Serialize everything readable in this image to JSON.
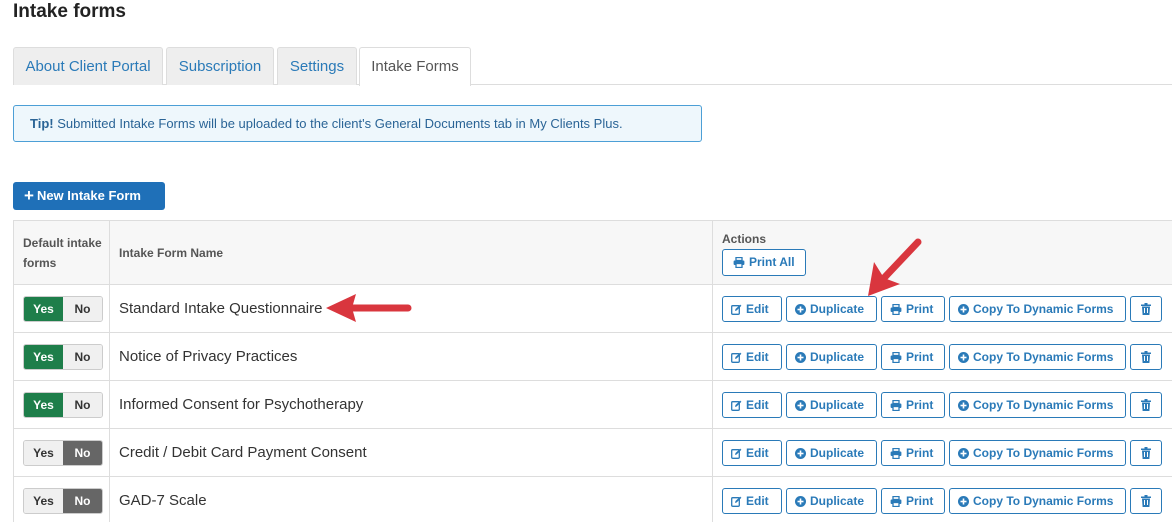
{
  "page": {
    "title": "Intake forms"
  },
  "tabs": [
    {
      "label": "About Client Portal",
      "active": false
    },
    {
      "label": "Subscription",
      "active": false
    },
    {
      "label": "Settings",
      "active": false
    },
    {
      "label": "Intake Forms",
      "active": true
    }
  ],
  "tip": {
    "strong": "Tip!",
    "text": " Submitted Intake Forms will be uploaded to the client's General Documents tab in My Clients Plus."
  },
  "new_button": {
    "label": "New Intake Form",
    "icon": "plus-icon"
  },
  "table": {
    "headers": {
      "default": "Default intake forms",
      "name": "Intake Form Name",
      "actions": "Actions"
    },
    "print_all_label": "Print All",
    "action_labels": {
      "edit": "Edit",
      "duplicate": "Duplicate",
      "print": "Print",
      "copy": "Copy To Dynamic Forms"
    },
    "toggle_labels": {
      "yes": "Yes",
      "no": "No"
    },
    "rows": [
      {
        "name": "Standard Intake Questionnaire",
        "default": true
      },
      {
        "name": "Notice of Privacy Practices",
        "default": true
      },
      {
        "name": "Informed Consent for Psychotherapy",
        "default": true
      },
      {
        "name": "Credit / Debit Card Payment Consent",
        "default": false
      },
      {
        "name": "GAD-7 Scale",
        "default": false
      }
    ]
  },
  "colors": {
    "accent": "#2a7ab8",
    "primary_button": "#1f70b8",
    "toggle_yes": "#1e7e4a",
    "toggle_no": "#666666",
    "annotation_arrow": "#d9363e"
  }
}
